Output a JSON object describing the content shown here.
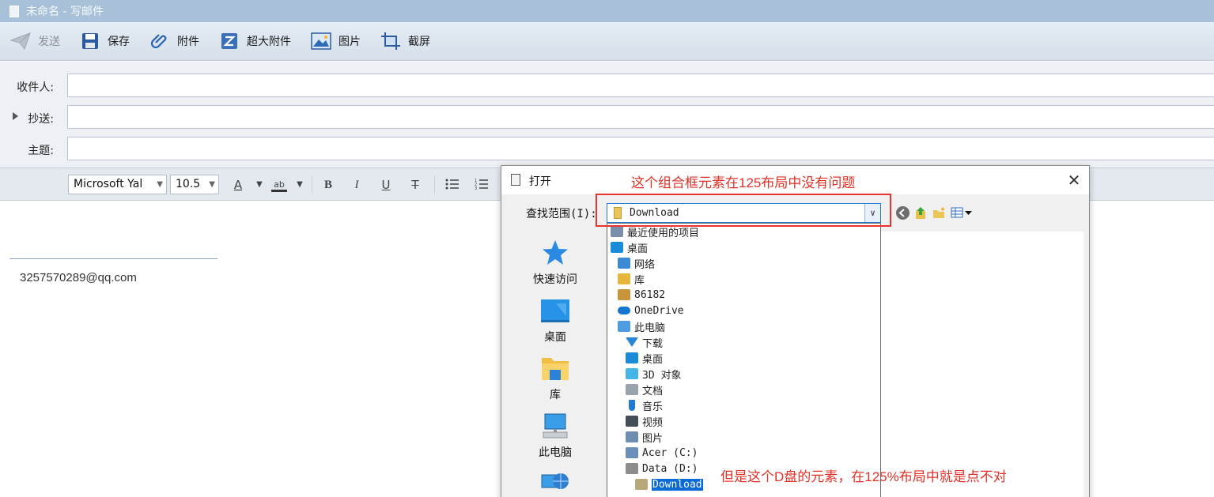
{
  "window": {
    "title": "未命名 - 写邮件"
  },
  "toolbar": {
    "send_label": "发送",
    "save_label": "保存",
    "attach_label": "附件",
    "big_attach_label": "超大附件",
    "picture_label": "图片",
    "screenshot_label": "截屏"
  },
  "fields": {
    "to_label": "收件人:",
    "cc_label": "抄送:",
    "subject_label": "主题:"
  },
  "format": {
    "font_family": "Microsoft Yal",
    "font_size": "10.5",
    "font_color_glyph": "A",
    "highlight_glyph": "ab",
    "bold_glyph": "B",
    "italic_glyph": "I",
    "underline_glyph": "U",
    "strike_glyph": "T"
  },
  "body": {
    "signature_email": "3257570289@qq.com"
  },
  "dialog": {
    "title": "打开",
    "lookin_label": "查找范围(I):",
    "lookin_value": "Download",
    "places": [
      {
        "label": "快速访问"
      },
      {
        "label": "桌面"
      },
      {
        "label": "库"
      },
      {
        "label": "此电脑"
      },
      {
        "label": ""
      }
    ],
    "dropdown_items": [
      {
        "label": "最近使用的项目",
        "icon": "recent-icon",
        "color": "#7a8fa8",
        "indent": 0
      },
      {
        "label": "桌面",
        "icon": "desktop-icon",
        "color": "#1a8ad9",
        "indent": 0
      },
      {
        "label": "网络",
        "icon": "network-icon",
        "color": "#3b8ad6",
        "indent": 1
      },
      {
        "label": "库",
        "icon": "library-icon",
        "color": "#e6b53a",
        "indent": 1
      },
      {
        "label": "86182",
        "icon": "user-icon",
        "color": "#c9943a",
        "indent": 1
      },
      {
        "label": "OneDrive",
        "icon": "cloud-icon",
        "color": "#1677d3",
        "indent": 1
      },
      {
        "label": "此电脑",
        "icon": "computer-icon",
        "color": "#4d9be0",
        "indent": 1
      },
      {
        "label": "下载",
        "icon": "download-icon",
        "color": "#2a86d8",
        "indent": 2
      },
      {
        "label": "桌面",
        "icon": "desktop-icon",
        "color": "#1a8ad9",
        "indent": 2
      },
      {
        "label": "3D 对象",
        "icon": "3d-objects-icon",
        "color": "#47b4e6",
        "indent": 2
      },
      {
        "label": "文档",
        "icon": "document-icon",
        "color": "#9aa3ad",
        "indent": 2
      },
      {
        "label": "音乐",
        "icon": "music-icon",
        "color": "#1f7bd3",
        "indent": 2
      },
      {
        "label": "视频",
        "icon": "video-icon",
        "color": "#444c57",
        "indent": 2
      },
      {
        "label": "图片",
        "icon": "pictures-icon",
        "color": "#6f8db0",
        "indent": 2
      },
      {
        "label": "Acer (C:)",
        "icon": "drive-c-icon",
        "color": "#6a8fb8",
        "indent": 2
      },
      {
        "label": "Data (D:)",
        "icon": "drive-d-icon",
        "color": "#8c8c8c",
        "indent": 2
      },
      {
        "label": "Download",
        "icon": "folder-icon",
        "color": "#b7a97a",
        "indent": 3,
        "selected": true
      }
    ]
  },
  "annotations": {
    "top": "这个组合框元素在125布局中没有问题",
    "bottom": "但是这个D盘的元素，在125%布局中就是点不对"
  },
  "colors": {
    "annotation_red": "#e03127",
    "selection_blue": "#0a6ad6"
  }
}
